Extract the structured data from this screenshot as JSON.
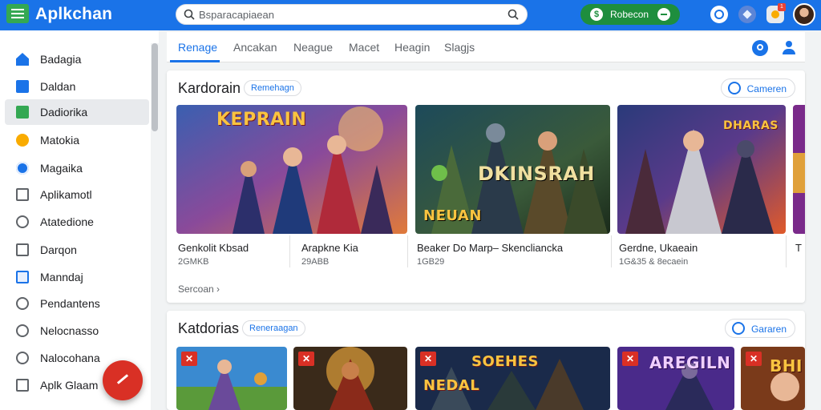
{
  "app": {
    "title": "Aplkchan"
  },
  "search": {
    "placeholder": "Bsparacapiaean"
  },
  "topbar": {
    "action_button": "Robecon",
    "notification_count": "1"
  },
  "sidebar": {
    "items": [
      {
        "label": "Badagia",
        "icon": "home-icon"
      },
      {
        "label": "Daldan",
        "icon": "monitor-icon"
      },
      {
        "label": "Dadiorika",
        "icon": "android-icon",
        "active": true
      },
      {
        "label": "Matokia",
        "icon": "medal-icon"
      },
      {
        "label": "Magaika",
        "icon": "gear-icon"
      },
      {
        "label": "Aplikamotl",
        "icon": "apps-icon"
      },
      {
        "label": "Atatedione",
        "icon": "clock-icon"
      },
      {
        "label": "Darqon",
        "icon": "tablet-icon"
      },
      {
        "label": "Manndaj",
        "icon": "checkbox-icon"
      },
      {
        "label": "Pendantens",
        "icon": "chat-icon"
      },
      {
        "label": "Nelocnasso",
        "icon": "timer-icon"
      },
      {
        "label": "Nalocohana",
        "icon": "bulb-icon"
      },
      {
        "label": "Aplk Glaam",
        "icon": "bookmark-icon"
      }
    ]
  },
  "tabs": [
    {
      "label": "Renage",
      "active": true
    },
    {
      "label": "Ancakan"
    },
    {
      "label": "Neague"
    },
    {
      "label": "Macet"
    },
    {
      "label": "Heagin"
    },
    {
      "label": "Slagjs"
    }
  ],
  "sections": [
    {
      "title": "Kardorain",
      "chip": "Remehagn",
      "see_all": "Cameren",
      "more": "Sercoan ›",
      "games": [
        {
          "art_text": "KEPRAIN",
          "name": "Genkolit Kbsad",
          "meta": "2GMKB"
        },
        {
          "art_text": "",
          "name": "Arapkne Kia",
          "meta": "29ABB"
        },
        {
          "art_text": "NEUAN",
          "art_text2": "DKINSRAH",
          "name": "Beaker Do Marp– Skencliancka",
          "meta": "1GB29"
        },
        {
          "art_text": "DHARAS",
          "name": "Gerdne, Ukaeain",
          "meta": "1G&35 & 8ecaein"
        },
        {
          "art_text": "",
          "name": "T",
          "meta": ""
        }
      ]
    },
    {
      "title": "Katdorias",
      "chip": "Reneraagan",
      "see_all": "Gararen",
      "games": [
        {
          "art_text": ""
        },
        {
          "art_text": ""
        },
        {
          "art_text": "NEDAL",
          "art_text2": "SOEHES"
        },
        {
          "art_text": "AREGILN"
        },
        {
          "art_text": "BHI"
        }
      ]
    }
  ],
  "colors": {
    "topbar": "#1a73e8",
    "accent": "#1a73e8",
    "green_button": "#1e8e3e",
    "fab": "#d93025"
  }
}
